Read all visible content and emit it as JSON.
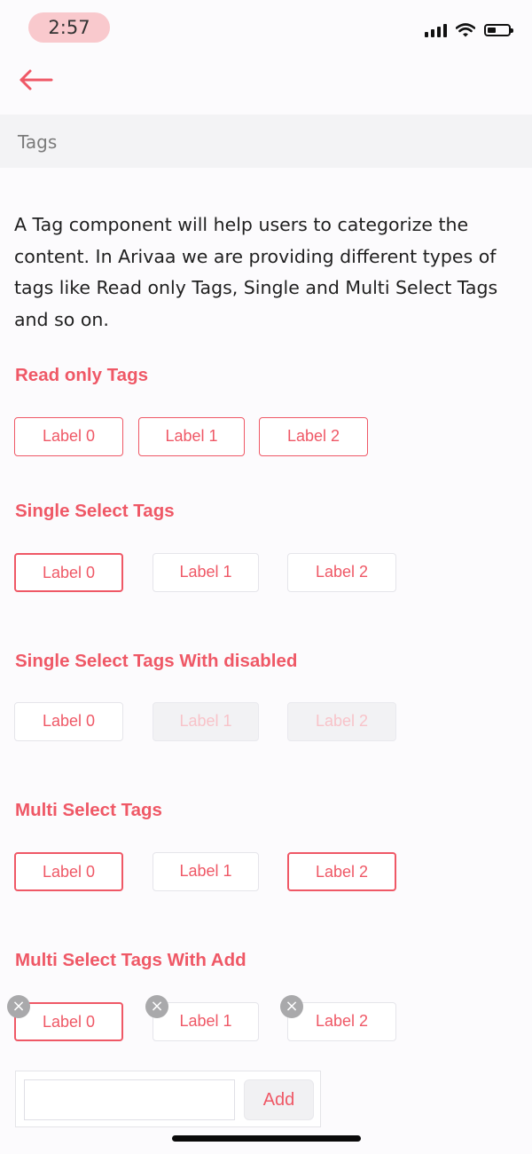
{
  "status_bar": {
    "time": "2:57"
  },
  "header": {
    "section_title": "Tags"
  },
  "intro_text": "A Tag component will help users to categorize the content. In Arivaa we are providing different types of tags like Read only Tags, Single and Multi Select Tags and so on.",
  "sections": [
    {
      "title": "Read only Tags",
      "tags": [
        {
          "label": "Label 0",
          "state": "readonly"
        },
        {
          "label": "Label 1",
          "state": "readonly"
        },
        {
          "label": "Label 2",
          "state": "readonly"
        }
      ]
    },
    {
      "title": "Single Select Tags",
      "tags": [
        {
          "label": "Label 0",
          "state": "selected"
        },
        {
          "label": "Label 1",
          "state": "unselected"
        },
        {
          "label": "Label 2",
          "state": "unselected"
        }
      ]
    },
    {
      "title": "Single Select Tags With disabled",
      "tags": [
        {
          "label": "Label 0",
          "state": "unselected"
        },
        {
          "label": "Label 1",
          "state": "disabled"
        },
        {
          "label": "Label 2",
          "state": "disabled"
        }
      ]
    },
    {
      "title": "Multi Select Tags",
      "tags": [
        {
          "label": "Label 0",
          "state": "selected"
        },
        {
          "label": "Label 1",
          "state": "unselected"
        },
        {
          "label": "Label 2",
          "state": "selected"
        }
      ]
    },
    {
      "title": "Multi Select Tags With Add",
      "tags": [
        {
          "label": "Label 0",
          "state": "selected"
        },
        {
          "label": "Label 1",
          "state": "unselected"
        },
        {
          "label": "Label 2",
          "state": "unselected"
        }
      ],
      "remove_icon": "close-circle-icon"
    }
  ],
  "add_form": {
    "input_value": "",
    "button_label": "Add"
  },
  "colors": {
    "accent": "#ef5866",
    "disabled_text": "#f8c3c9",
    "section_bar": "#f3f3f5"
  },
  "icons": {
    "back": "arrow-left-icon",
    "signal": "signal-icon",
    "wifi": "wifi-icon",
    "battery": "battery-icon"
  }
}
